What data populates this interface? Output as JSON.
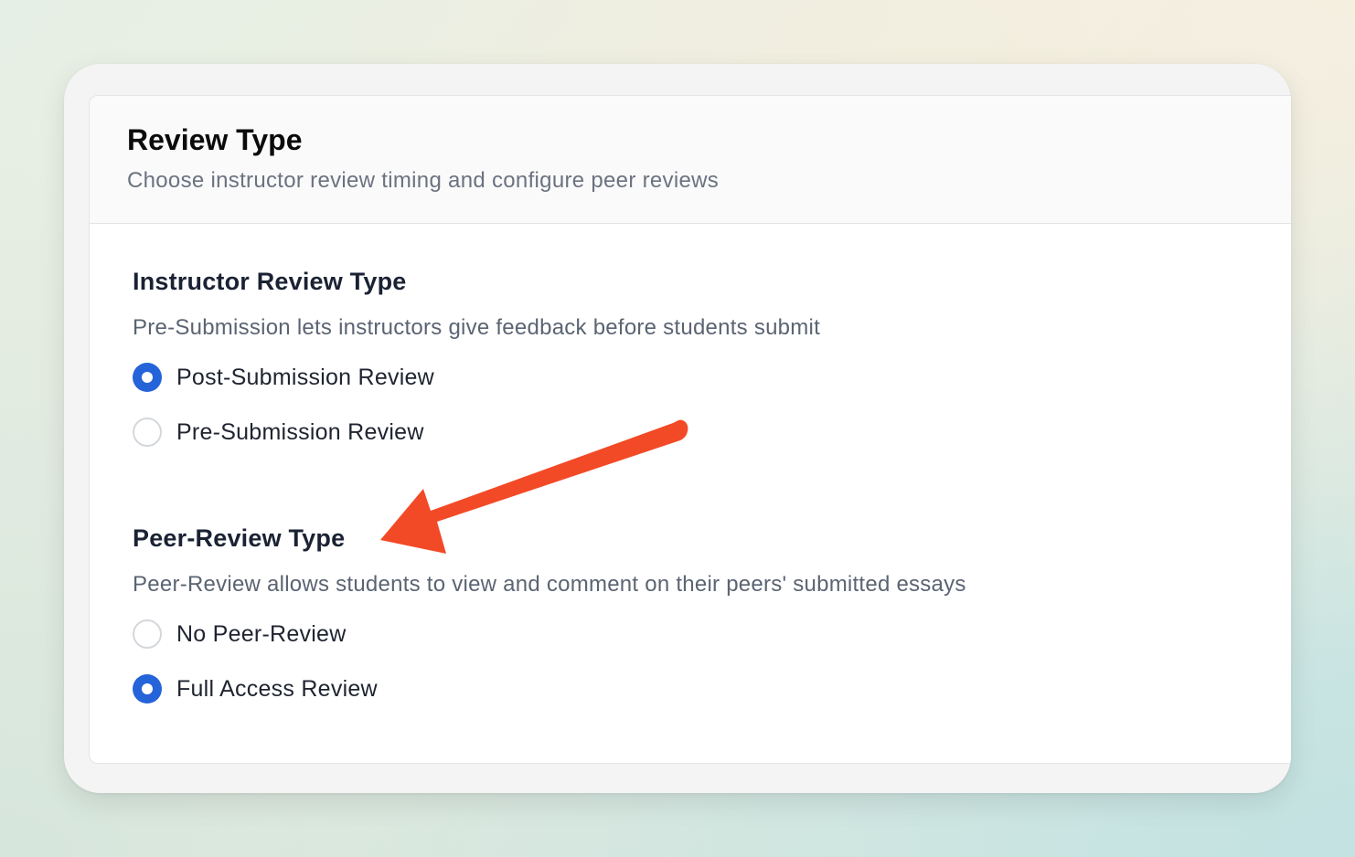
{
  "card": {
    "title": "Review Type",
    "subtitle": "Choose instructor review timing and configure peer reviews"
  },
  "instructor_review": {
    "title": "Instructor Review Type",
    "description": "Pre-Submission lets instructors give feedback before students submit",
    "options": [
      {
        "label": "Post-Submission Review",
        "selected": true
      },
      {
        "label": "Pre-Submission Review",
        "selected": false
      }
    ]
  },
  "peer_review": {
    "title": "Peer-Review Type",
    "description": "Peer-Review allows students to view and comment on their peers' submitted essays",
    "options": [
      {
        "label": "No Peer-Review",
        "selected": false
      },
      {
        "label": "Full Access Review",
        "selected": true
      }
    ]
  },
  "colors": {
    "accent": "#2563d9",
    "annotation_arrow": "#f24a26"
  },
  "annotation": {
    "icon": "arrow-annotation-icon"
  }
}
